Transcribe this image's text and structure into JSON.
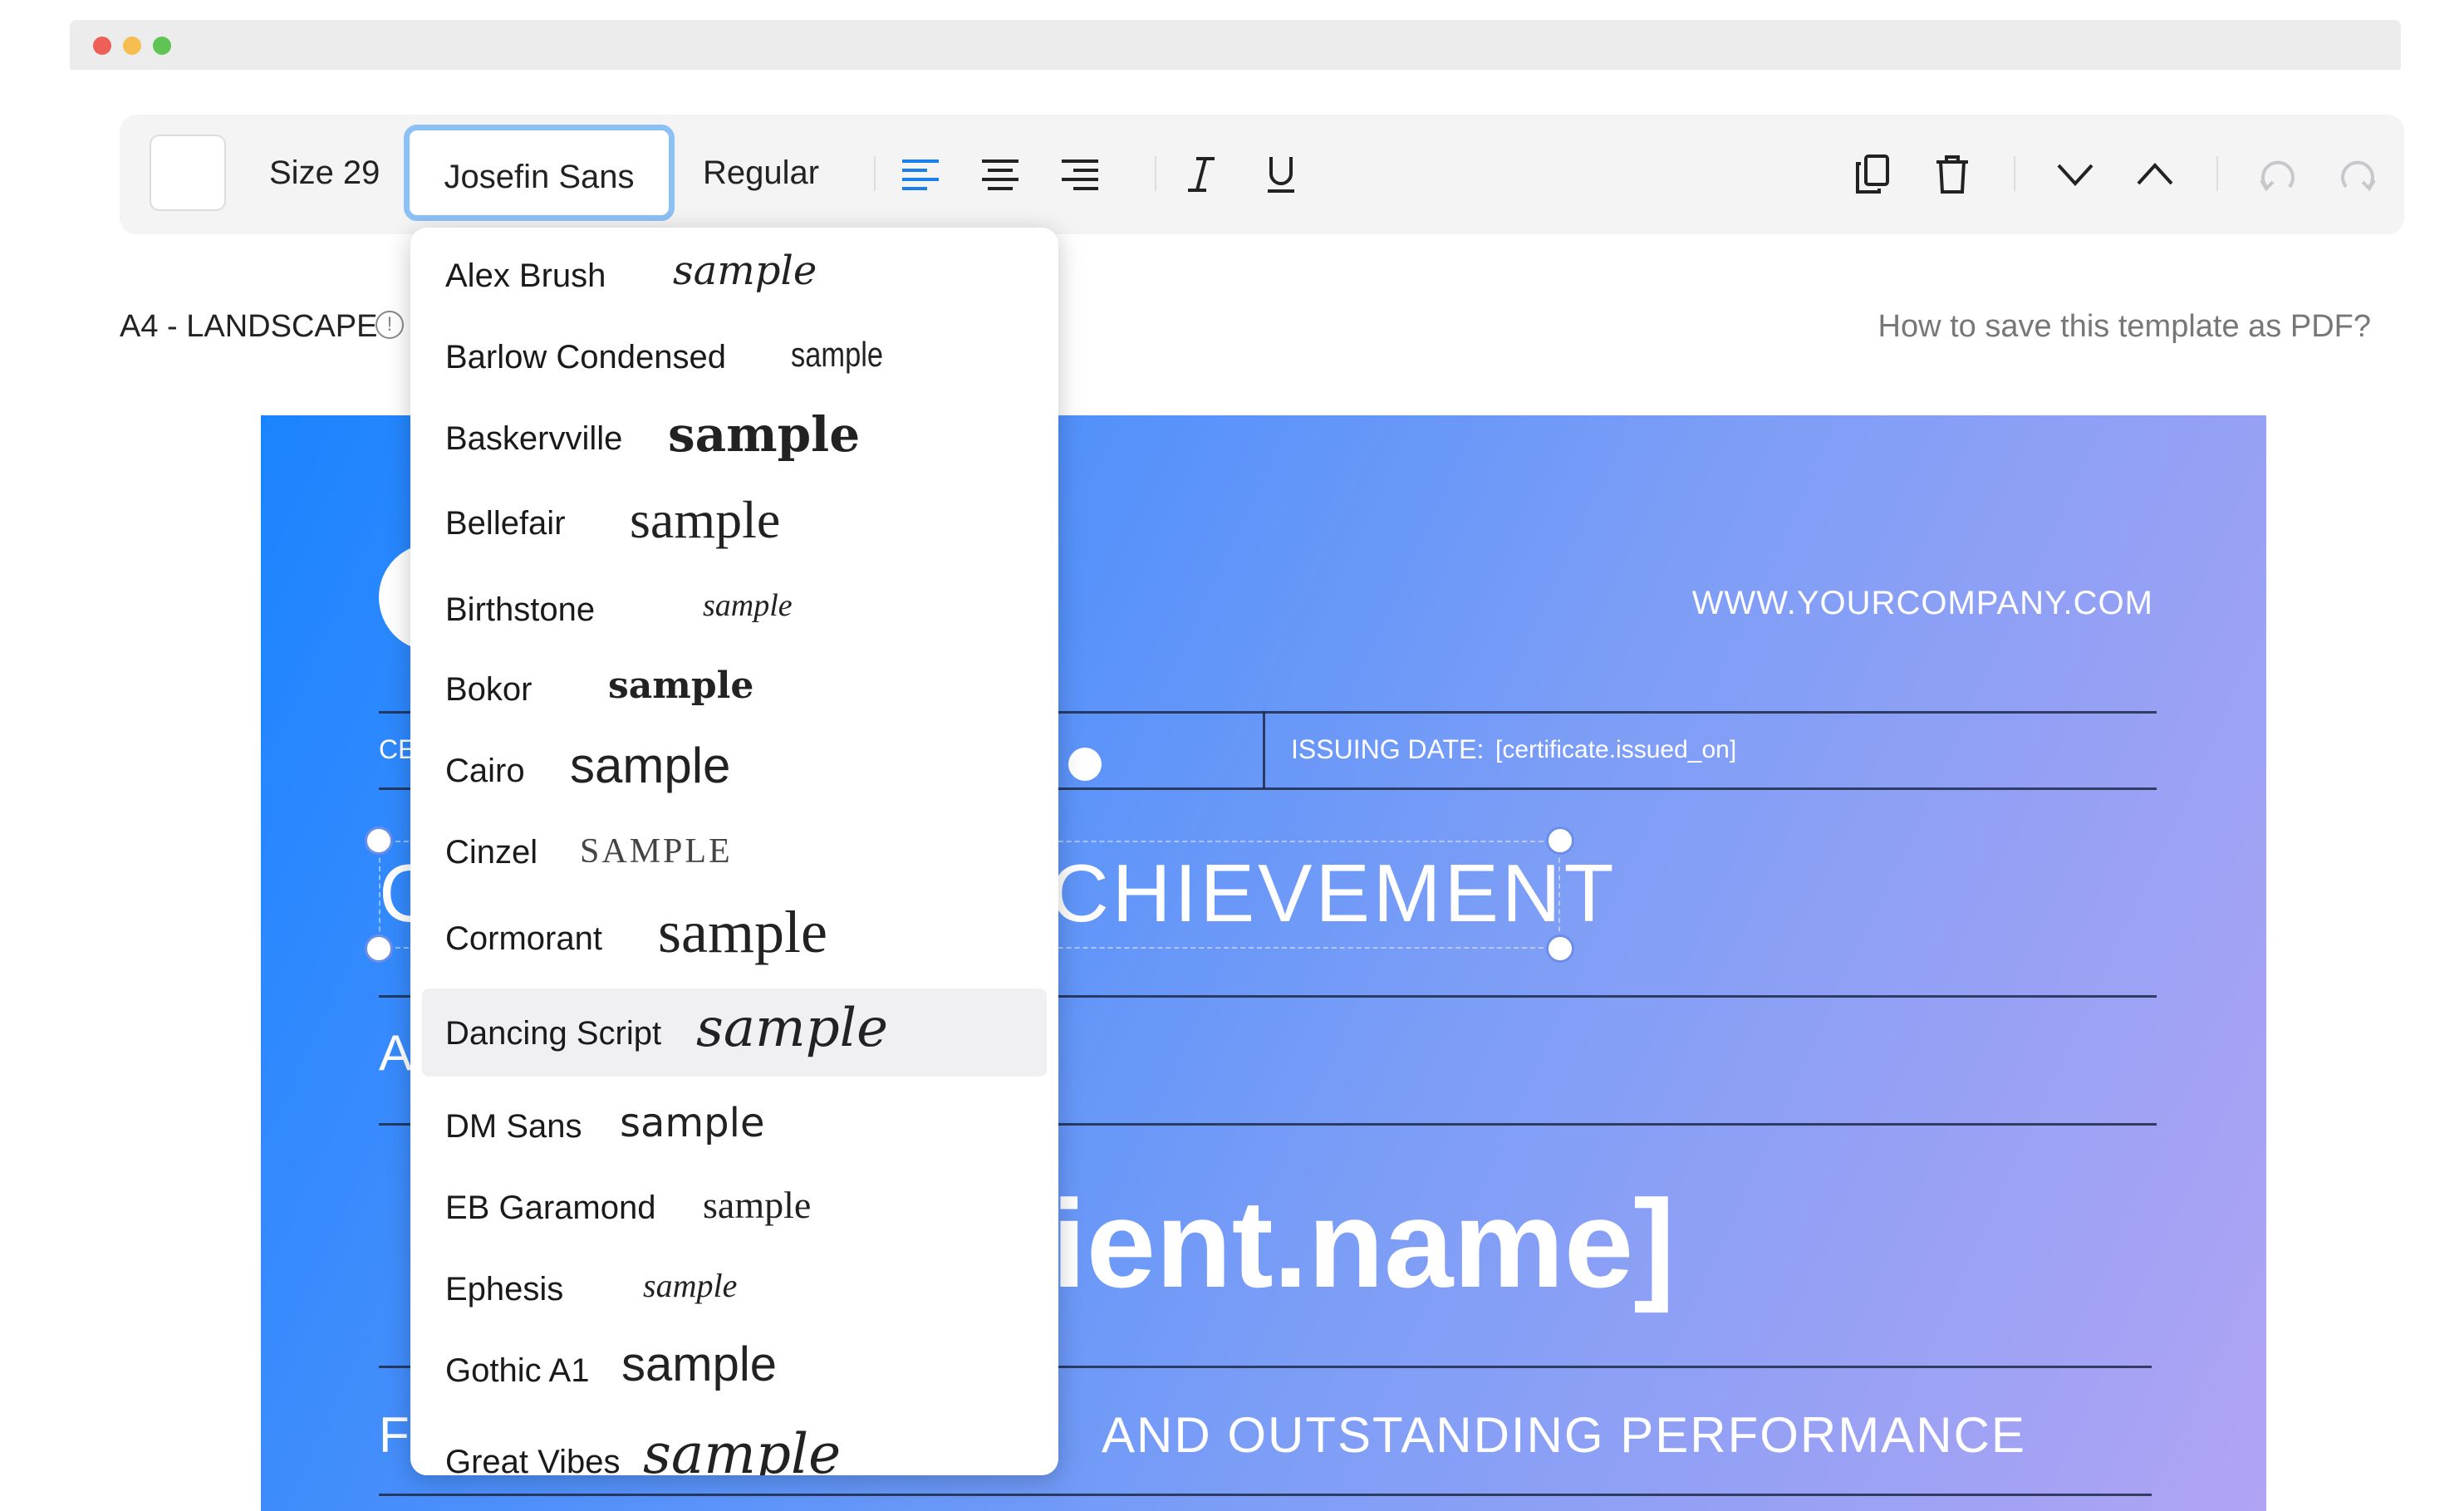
{
  "toolbar": {
    "size_label": "Size 29",
    "font_value": "Josefin Sans",
    "weight_value": "Regular"
  },
  "info": {
    "page_format": "A4 - LANDSCAPE",
    "help_link": "How to save this template as PDF?"
  },
  "certificate": {
    "website": "WWW.YOURCOMPANY.COM",
    "cert_label_partial": "CE",
    "issuing_date_label": "ISSUING DATE:",
    "issuing_date_value": "[certificate.issued_on]",
    "title_prefix": "C",
    "title_visible": "CHIEVEMENT",
    "award_prefix": "A",
    "recipient_visible": "ient.name]",
    "reason_prefix": "F",
    "reason_visible": "AND OUTSTANDING PERFORMANCE"
  },
  "font_dropdown": {
    "selected": "Dancing Script",
    "items": [
      {
        "name": "Alex Brush",
        "sample": "sample"
      },
      {
        "name": "Barlow Condensed",
        "sample": "sample"
      },
      {
        "name": "Baskervville",
        "sample": "sample"
      },
      {
        "name": "Bellefair",
        "sample": "sample"
      },
      {
        "name": "Birthstone",
        "sample": "sample"
      },
      {
        "name": "Bokor",
        "sample": "sample"
      },
      {
        "name": "Cairo",
        "sample": "sample"
      },
      {
        "name": "Cinzel",
        "sample": "SAMPLE"
      },
      {
        "name": "Cormorant",
        "sample": "sample"
      },
      {
        "name": "Dancing Script",
        "sample": "sample"
      },
      {
        "name": "DM Sans",
        "sample": "sample"
      },
      {
        "name": "EB Garamond",
        "sample": "sample"
      },
      {
        "name": "Ephesis",
        "sample": "sample"
      },
      {
        "name": "Gothic A1",
        "sample": "sample"
      },
      {
        "name": "Great Vibes",
        "sample": "sample"
      }
    ]
  },
  "icons": {
    "align": [
      "align-left-icon",
      "align-center-icon",
      "align-right-icon"
    ],
    "style": [
      "italic-icon",
      "underline-icon"
    ],
    "actions": [
      "duplicate-icon",
      "trash-icon",
      "move-down-icon",
      "move-up-icon",
      "undo-icon",
      "redo-icon"
    ]
  },
  "colors": {
    "accent": "#1a7fe8",
    "focus_ring": "#8cc1f6",
    "gradient_start": "#1a84ff",
    "gradient_end": "#b0a4f3"
  }
}
